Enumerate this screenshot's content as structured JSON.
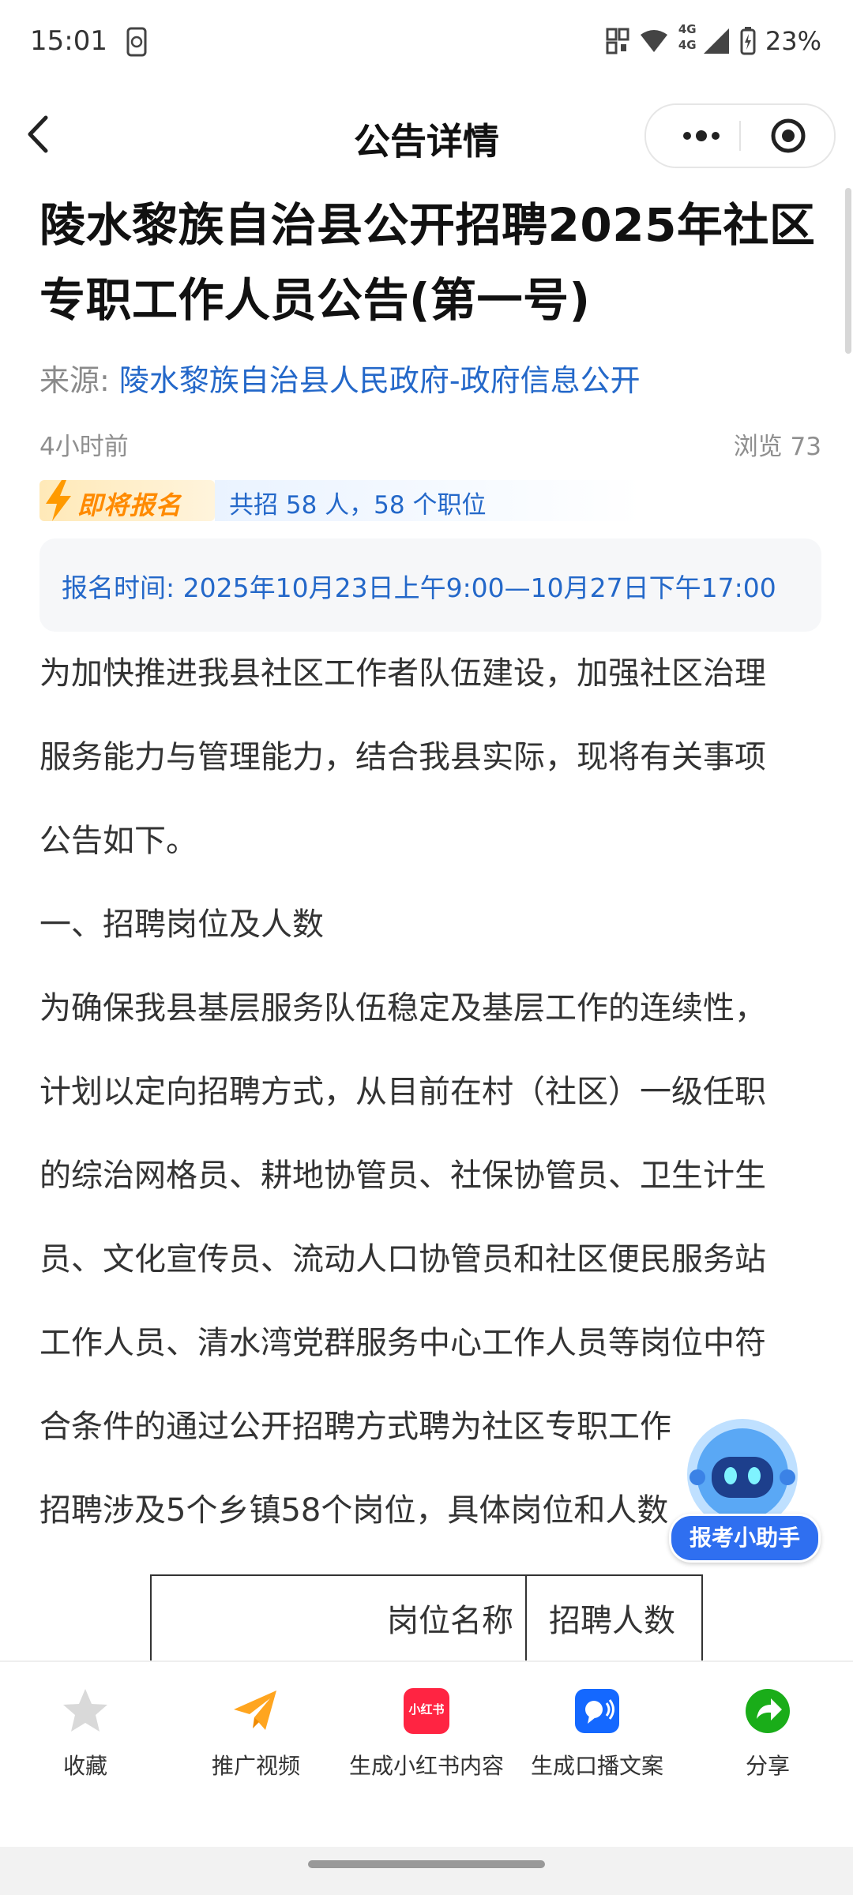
{
  "status_bar": {
    "time": "15:01",
    "network": "4G",
    "battery": "23%"
  },
  "nav": {
    "title": "公告详情"
  },
  "article": {
    "title_line1": "陵水黎族自治县公开招聘2025年社区",
    "title_line2": "专职工作人员公告(第一号)",
    "source_label": "来源:",
    "source_name": "陵水黎族自治县人民政府-政府信息公开",
    "time_ago": "4小时前",
    "views": "浏览 73",
    "tag_label": "即将报名",
    "tag_info": "共招 58 人，58 个职位",
    "signup_time": "报名时间: 2025年10月23日上午9:00—10月27日下午17:00",
    "lines": [
      "为加快推进我县社区工作者队伍建设，加强社区治理",
      "服务能力与管理能力，结合我县实际，现将有关事项",
      "公告如下。",
      "一、招聘岗位及人数",
      "为确保我县基层服务队伍稳定及基层工作的连续性，",
      "计划以定向招聘方式，从目前在村（社区）一级任职",
      "的综治网格员、耕地协管员、社保协管员、卫生计生",
      "员、文化宣传员、流动人口协管员和社区便民服务站",
      "工作人员、清水湾党群服务中心工作人员等岗位中符",
      "合条件的通过公开招聘方式聘为社区专职工作",
      "招聘涉及5个乡镇58个岗位，具体岗位和人数"
    ],
    "table_headers": [
      "岗位名称",
      "招聘人数"
    ]
  },
  "assistant": {
    "label": "报考小助手"
  },
  "toolbar": {
    "items": [
      {
        "label": "收藏",
        "icon": "star-icon"
      },
      {
        "label": "推广视频",
        "icon": "paper-plane-icon"
      },
      {
        "label": "生成小红书内容",
        "icon": "xiaohongshu-icon",
        "icon_text": "小红书"
      },
      {
        "label": "生成口播文案",
        "icon": "voice-icon"
      },
      {
        "label": "分享",
        "icon": "share-icon"
      }
    ]
  },
  "colors": {
    "link_blue": "#2468c9",
    "tag_orange": "#ff8a00",
    "xhs_red": "#ff2442",
    "share_green": "#1aad19"
  }
}
